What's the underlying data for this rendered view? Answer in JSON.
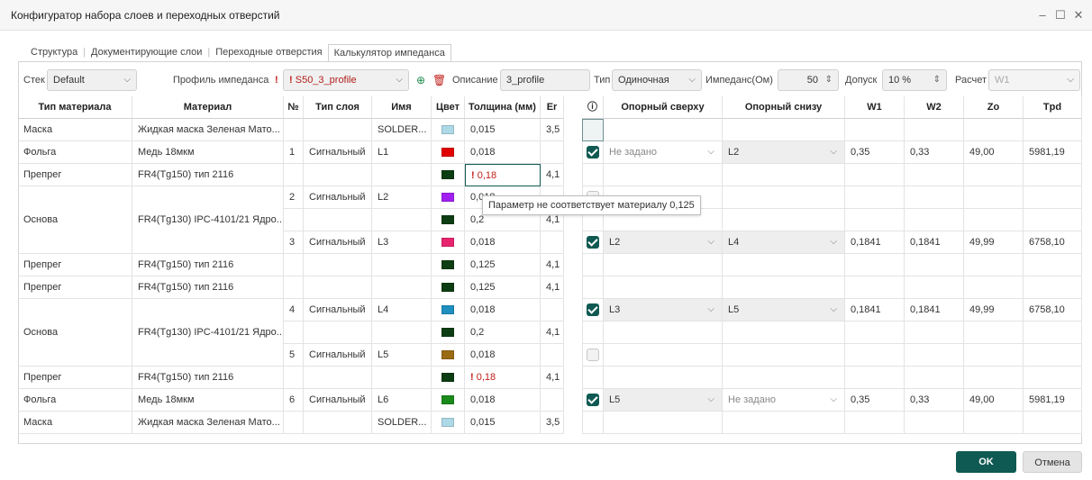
{
  "window": {
    "title": "Конфигуратор набора слоев и переходных отверстий",
    "controls": [
      "–",
      "☐",
      "✕"
    ]
  },
  "tabs": [
    "Структура",
    "Документирующие слои",
    "Переходные отверстия",
    "Калькулятор импеданса"
  ],
  "active_tab": "Калькулятор импеданса",
  "toolbar": {
    "stack_label": "Стек",
    "stack_value": "Default",
    "profile_label": "Профиль импеданса",
    "profile_value": "S50_3_profile",
    "description_label": "Описание",
    "description_value": "3_profile",
    "type_label": "Тип",
    "type_value": "Одиночная",
    "impedance_label": "Импеданс(Ом)",
    "impedance_value": "50",
    "tolerance_label": "Допуск",
    "tolerance_value": "10 %",
    "calc_label": "Расчет",
    "calc_value": "W1",
    "warn_mark": "!",
    "add_icon": "add-circle-icon",
    "delete_icon": "trash-icon"
  },
  "headers": {
    "material_type": "Тип материала",
    "material": "Материал",
    "num": "№",
    "layer_type": "Тип слоя",
    "name": "Имя",
    "color": "Цвет",
    "thickness": "Толщина (мм)",
    "er": "Er",
    "info": "ⓘ",
    "ref_top": "Опорный сверху",
    "ref_bottom": "Опорный снизу",
    "w1": "W1",
    "w2": "W2",
    "zo": "Zo",
    "tpd": "Tpd"
  },
  "material_groups": [
    {
      "type": "Маска",
      "material": "Жидкая маска Зеленая Мато..."
    },
    {
      "type": "Фольга",
      "material": "Медь 18мкм"
    },
    {
      "type": "Препрег",
      "material": "FR4(Tg150) тип 2116"
    },
    {
      "type": "Основа",
      "material": "FR4(Tg130) IPC-4101/21 Ядро..."
    },
    {
      "type": "Препрег",
      "material": "FR4(Tg150) тип 2116"
    },
    {
      "type": "Препрег",
      "material": "FR4(Tg150) тип 2116"
    },
    {
      "type": "Основа",
      "material": "FR4(Tg130) IPC-4101/21 Ядро..."
    },
    {
      "type": "Препрег",
      "material": "FR4(Tg150) тип 2116"
    },
    {
      "type": "Фольга",
      "material": "Медь 18мкм"
    },
    {
      "type": "Маска",
      "material": "Жидкая маска Зеленая Мато..."
    }
  ],
  "rows": [
    {
      "num": "",
      "layer_type": "",
      "name": "SOLDER...",
      "color": "#add8e6",
      "thickness": "0,015",
      "er": "3,5",
      "warn": false,
      "check": "none",
      "ref_top": "",
      "ref_bottom": "",
      "w1": "",
      "w2": "",
      "zo": "",
      "tpd": ""
    },
    {
      "num": "1",
      "layer_type": "Сигнальный",
      "name": "L1",
      "color": "#e00000",
      "thickness": "0,018",
      "er": "",
      "warn": false,
      "check": "on",
      "ref_top": "Не задано",
      "ref_bottom": "L2",
      "w1": "0,35",
      "w2": "0,33",
      "zo": "49,00",
      "tpd": "5981,19"
    },
    {
      "num": "",
      "layer_type": "",
      "name": "",
      "color": "#0d3d12",
      "thickness": "0,18",
      "er": "4,1",
      "warn": true,
      "check": "none",
      "ref_top": "",
      "ref_bottom": "",
      "w1": "",
      "w2": "",
      "zo": "",
      "tpd": ""
    },
    {
      "num": "2",
      "layer_type": "Сигнальный",
      "name": "L2",
      "color": "#a020f0",
      "thickness": "0,018",
      "er": "",
      "warn": false,
      "check": "off",
      "ref_top": "",
      "ref_bottom": "",
      "w1": "",
      "w2": "",
      "zo": "",
      "tpd": ""
    },
    {
      "num": "",
      "layer_type": "",
      "name": "",
      "color": "#0d3d12",
      "thickness": "0,2",
      "er": "4,1",
      "warn": false,
      "check": "none",
      "ref_top": "",
      "ref_bottom": "",
      "w1": "",
      "w2": "",
      "zo": "",
      "tpd": ""
    },
    {
      "num": "3",
      "layer_type": "Сигнальный",
      "name": "L3",
      "color": "#e8246f",
      "thickness": "0,018",
      "er": "",
      "warn": false,
      "check": "on",
      "ref_top": "L2",
      "ref_bottom": "L4",
      "w1": "0,1841",
      "w2": "0,1841",
      "zo": "49,99",
      "tpd": "6758,10"
    },
    {
      "num": "",
      "layer_type": "",
      "name": "",
      "color": "#0d3d12",
      "thickness": "0,125",
      "er": "4,1",
      "warn": false,
      "check": "none",
      "ref_top": "",
      "ref_bottom": "",
      "w1": "",
      "w2": "",
      "zo": "",
      "tpd": ""
    },
    {
      "num": "",
      "layer_type": "",
      "name": "",
      "color": "#0d3d12",
      "thickness": "0,125",
      "er": "4,1",
      "warn": false,
      "check": "none",
      "ref_top": "",
      "ref_bottom": "",
      "w1": "",
      "w2": "",
      "zo": "",
      "tpd": ""
    },
    {
      "num": "4",
      "layer_type": "Сигнальный",
      "name": "L4",
      "color": "#1e8fbf",
      "thickness": "0,018",
      "er": "",
      "warn": false,
      "check": "on",
      "ref_top": "L3",
      "ref_bottom": "L5",
      "w1": "0,1841",
      "w2": "0,1841",
      "zo": "49,99",
      "tpd": "6758,10"
    },
    {
      "num": "",
      "layer_type": "",
      "name": "",
      "color": "#0d3d12",
      "thickness": "0,2",
      "er": "4,1",
      "warn": false,
      "check": "none",
      "ref_top": "",
      "ref_bottom": "",
      "w1": "",
      "w2": "",
      "zo": "",
      "tpd": ""
    },
    {
      "num": "5",
      "layer_type": "Сигнальный",
      "name": "L5",
      "color": "#9a6a14",
      "thickness": "0,018",
      "er": "",
      "warn": false,
      "check": "off",
      "ref_top": "",
      "ref_bottom": "",
      "w1": "",
      "w2": "",
      "zo": "",
      "tpd": ""
    },
    {
      "num": "",
      "layer_type": "",
      "name": "",
      "color": "#0d3d12",
      "thickness": "0,18",
      "er": "4,1",
      "warn": true,
      "check": "none",
      "ref_top": "",
      "ref_bottom": "",
      "w1": "",
      "w2": "",
      "zo": "",
      "tpd": ""
    },
    {
      "num": "6",
      "layer_type": "Сигнальный",
      "name": "L6",
      "color": "#1a8a1a",
      "thickness": "0,018",
      "er": "",
      "warn": false,
      "check": "on",
      "ref_top": "L5",
      "ref_bottom": "Не задано",
      "w1": "0,35",
      "w2": "0,33",
      "zo": "49,00",
      "tpd": "5981,19"
    },
    {
      "num": "",
      "layer_type": "",
      "name": "SOLDER...",
      "color": "#add8e6",
      "thickness": "0,015",
      "er": "3,5",
      "warn": false,
      "check": "none",
      "ref_top": "",
      "ref_bottom": "",
      "w1": "",
      "w2": "",
      "zo": "",
      "tpd": ""
    }
  ],
  "tooltip": "Параметр не соответствует материалу 0,125",
  "buttons": {
    "ok": "OK",
    "cancel": "Отмена"
  }
}
